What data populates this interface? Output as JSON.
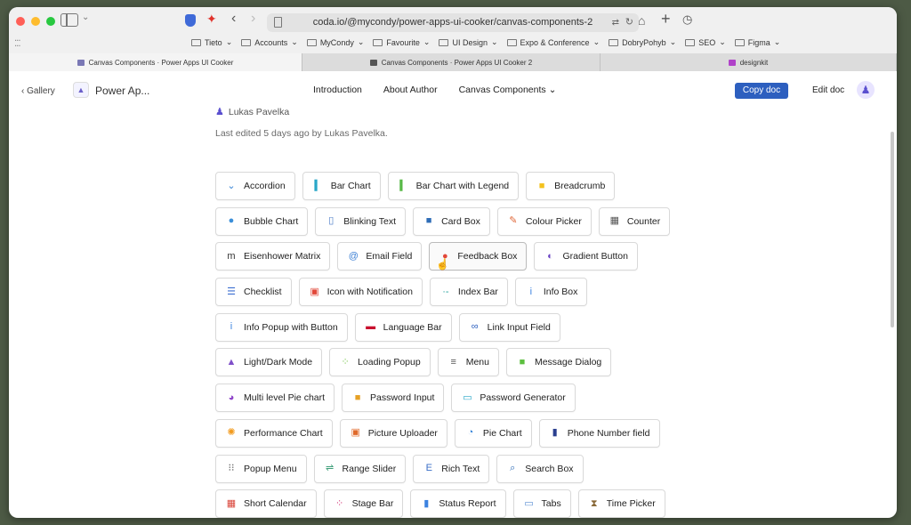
{
  "browser": {
    "url": "coda.io/@mycondy/power-apps-ui-cooker/canvas-components-2",
    "bookmarks": [
      "Tieto",
      "Accounts",
      "MyCondy",
      "Favourite",
      "UI Design",
      "Expo & Conference",
      "DobryPohyb",
      "SEO",
      "Figma"
    ],
    "tabs": [
      {
        "label": "Canvas Components · Power Apps UI Cooker",
        "icon_color": "#7a78b5"
      },
      {
        "label": "Canvas Components · Power Apps UI Cooker 2",
        "icon_color": "#555555"
      },
      {
        "label": "designkit",
        "icon_color": "#b042c9"
      }
    ]
  },
  "header": {
    "gallery": "‹ Gallery",
    "doc_name": "Power Ap...",
    "nav": [
      "Introduction",
      "About Author",
      "Canvas Components ⌄"
    ],
    "copy_doc": "Copy doc",
    "edit_doc": "Edit doc",
    "accent": "#2d5fbf"
  },
  "meta": {
    "author": "Lukas Pavelka",
    "edited": "Last edited 5 days ago by Lukas Pavelka."
  },
  "components": [
    [
      {
        "label": "Accordion",
        "icon": "chevron-down-icon",
        "glyph": "⌄",
        "color": "#3a86d6"
      },
      {
        "label": "Bar Chart",
        "icon": "bar-chart-icon",
        "glyph": "▍",
        "color": "#2aa7c8"
      },
      {
        "label": "Bar Chart with Legend",
        "icon": "bar-chart-legend-icon",
        "glyph": "▍",
        "color": "#58b947"
      },
      {
        "label": "Breadcrumb",
        "icon": "breadcrumb-icon",
        "glyph": "■",
        "color": "#f4c21e"
      }
    ],
    [
      {
        "label": "Bubble Chart",
        "icon": "bubble-chart-icon",
        "glyph": "●",
        "color": "#3b8fd9"
      },
      {
        "label": "Blinking Text",
        "icon": "document-icon",
        "glyph": "▯",
        "color": "#4d7cc7"
      },
      {
        "label": "Card Box",
        "icon": "card-icon",
        "glyph": "■",
        "color": "#2f6db7"
      },
      {
        "label": "Colour Picker",
        "icon": "eyedropper-icon",
        "glyph": "✎",
        "color": "#e0683a"
      },
      {
        "label": "Counter",
        "icon": "counter-icon",
        "glyph": "▦",
        "color": "#555555"
      }
    ],
    [
      {
        "label": "Eisenhower Matrix",
        "icon": "matrix-icon",
        "glyph": "m",
        "color": "#333333"
      },
      {
        "label": "Email Field",
        "icon": "at-icon",
        "glyph": "@",
        "color": "#3b7fd4"
      },
      {
        "label": "Feedback Box",
        "icon": "feedback-icon",
        "glyph": "●",
        "color": "#e2483a"
      },
      {
        "label": "Gradient Button",
        "icon": "gradient-icon",
        "glyph": "◐",
        "color": "#6a43c4"
      }
    ],
    [
      {
        "label": "Checklist",
        "icon": "checklist-icon",
        "glyph": "☰",
        "color": "#3c6fd1"
      },
      {
        "label": "Icon with Notification",
        "icon": "notification-icon",
        "glyph": "▣",
        "color": "#e2483a"
      },
      {
        "label": "Index Bar",
        "icon": "index-bar-icon",
        "glyph": "·-",
        "color": "#27a29c"
      },
      {
        "label": "Info Box",
        "icon": "info-icon",
        "glyph": "i",
        "color": "#3b82e0"
      }
    ],
    [
      {
        "label": "Info Popup with Button",
        "icon": "info-popup-icon",
        "glyph": "i",
        "color": "#3b82e0"
      },
      {
        "label": "Language Bar",
        "icon": "flag-uk-icon",
        "glyph": "▬",
        "color": "#c8102e"
      },
      {
        "label": "Link Input Field",
        "icon": "link-icon",
        "glyph": "∞",
        "color": "#2c5fbf"
      }
    ],
    [
      {
        "label": "Light/Dark Mode",
        "icon": "mountain-icon",
        "glyph": "▲",
        "color": "#7f4fc9"
      },
      {
        "label": "Loading Popup",
        "icon": "spinner-icon",
        "glyph": "⁘",
        "color": "#7ac74f"
      },
      {
        "label": "Menu",
        "icon": "hamburger-icon",
        "glyph": "≡",
        "color": "#555555"
      },
      {
        "label": "Message Dialog",
        "icon": "message-icon",
        "glyph": "■",
        "color": "#5cbf3f"
      }
    ],
    [
      {
        "label": "Multi level Pie chart",
        "icon": "pie-multi-icon",
        "glyph": "◕",
        "color": "#8e44c9"
      },
      {
        "label": "Password Input",
        "icon": "lock-icon",
        "glyph": "■",
        "color": "#e6a126"
      },
      {
        "label": "Password Generator",
        "icon": "password-generator-icon",
        "glyph": "▭",
        "color": "#2aa7c8"
      }
    ],
    [
      {
        "label": "Performance Chart",
        "icon": "sun-icon",
        "glyph": "✺",
        "color": "#f29b1e"
      },
      {
        "label": "Picture Uploader",
        "icon": "picture-icon",
        "glyph": "▣",
        "color": "#e06a2a"
      },
      {
        "label": "Pie Chart",
        "icon": "pie-icon",
        "glyph": "◔",
        "color": "#2f80d8"
      },
      {
        "label": "Phone Number field",
        "icon": "phone-book-icon",
        "glyph": "▮",
        "color": "#2a3f8f"
      }
    ],
    [
      {
        "label": "Popup Menu",
        "icon": "grid-icon",
        "glyph": "⁝⁝",
        "color": "#555555"
      },
      {
        "label": "Range Slider",
        "icon": "slider-icon",
        "glyph": "⇌",
        "color": "#3fa07a"
      },
      {
        "label": "Rich Text",
        "icon": "rich-text-icon",
        "glyph": "E",
        "color": "#3b6fc7"
      },
      {
        "label": "Search Box",
        "icon": "search-icon",
        "glyph": "⌕",
        "color": "#2f6db7"
      }
    ],
    [
      {
        "label": "Short Calendar",
        "icon": "calendar-icon",
        "glyph": "▦",
        "color": "#d9453a"
      },
      {
        "label": "Stage Bar",
        "icon": "stage-bar-icon",
        "glyph": "⁘",
        "color": "#d43a7a"
      },
      {
        "label": "Status Report",
        "icon": "status-report-icon",
        "glyph": "▮",
        "color": "#3b82e0"
      },
      {
        "label": "Tabs",
        "icon": "tabs-icon",
        "glyph": "▭",
        "color": "#5b8fd4"
      },
      {
        "label": "Time Picker",
        "icon": "hourglass-icon",
        "glyph": "⧗",
        "color": "#8a6a3a"
      }
    ]
  ]
}
